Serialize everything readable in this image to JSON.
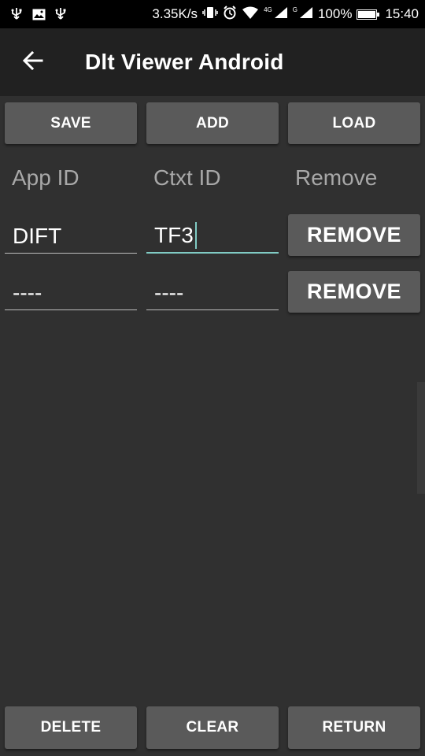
{
  "status_bar": {
    "left_icons": [
      "usb-icon",
      "image-icon",
      "usb-icon"
    ],
    "net_speed": "3.35K/s",
    "lte_label": "4G",
    "g_label": "G",
    "battery_percent": "100%",
    "battery_level": 1.0,
    "time": "15:40"
  },
  "app_bar": {
    "title": "Dlt Viewer Android"
  },
  "toolbar": {
    "save_label": "SAVE",
    "add_label": "ADD",
    "load_label": "LOAD"
  },
  "columns": {
    "app_id": "App ID",
    "ctxt_id": "Ctxt ID",
    "remove": "Remove"
  },
  "rows": [
    {
      "app_id": "DIFT",
      "ctxt_id": "TF3",
      "remove_label": "REMOVE"
    },
    {
      "app_id": "----",
      "ctxt_id": "----",
      "remove_label": "REMOVE"
    }
  ],
  "bottom_bar": {
    "delete_label": "DELETE",
    "clear_label": "CLEAR",
    "return_label": "RETURN"
  },
  "colors": {
    "background": "#303030",
    "app_bar": "#212121",
    "button": "#5a5a5a",
    "accent": "#80cbc4"
  }
}
